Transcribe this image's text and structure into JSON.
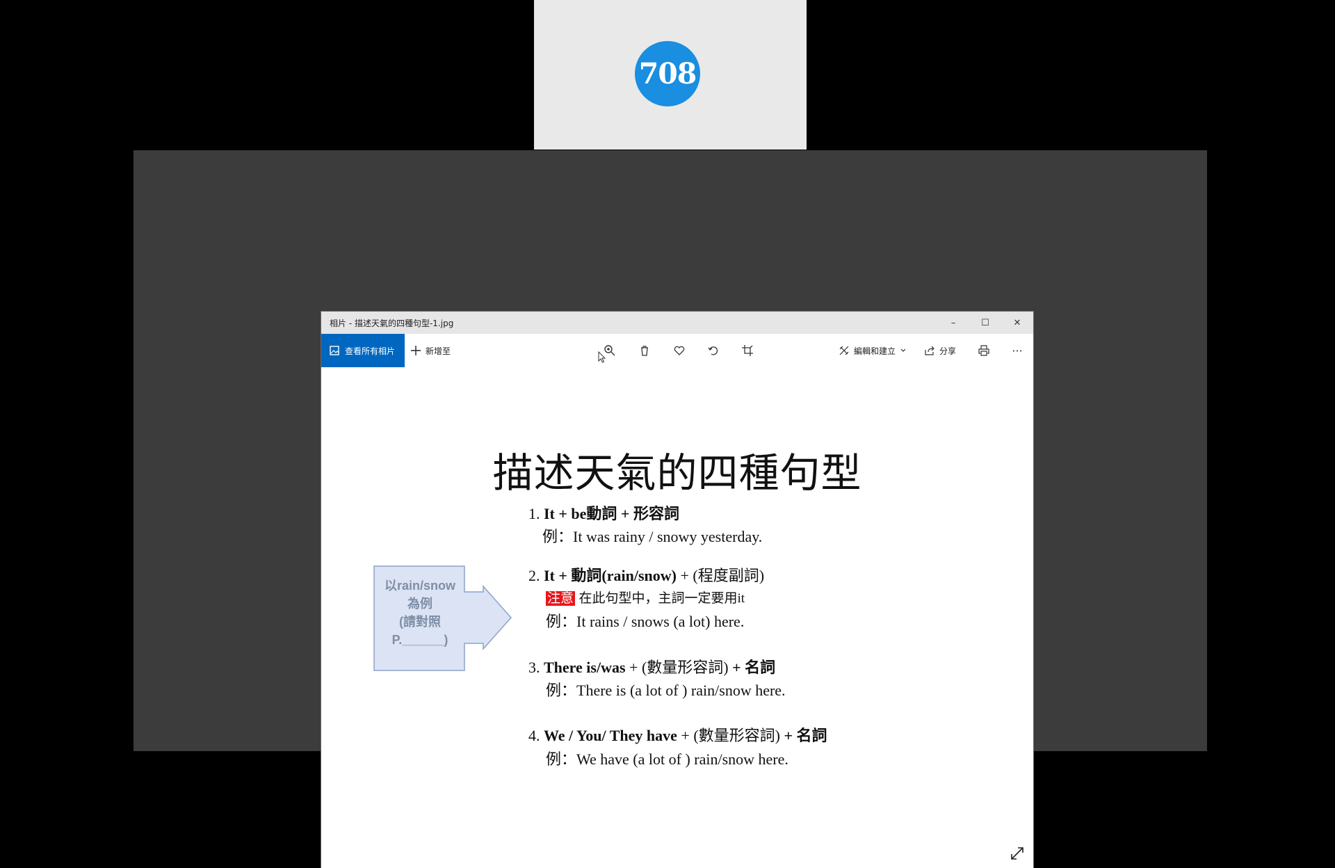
{
  "participant": {
    "name_tile": "708",
    "accent": "#1a8ee0"
  },
  "window": {
    "title": "相片 - 描述天氣的四種句型-1.jpg",
    "controls": {
      "minimize": "–",
      "maximize": "☐",
      "close": "✕"
    }
  },
  "toolbar": {
    "view_all_label": "查看所有相片",
    "add_to_label": "新增至",
    "icons": [
      "zoom-icon",
      "delete-icon",
      "favorite-icon",
      "rotate-icon",
      "crop-icon"
    ],
    "edit_create_label": "編輯和建立",
    "share_label": "分享",
    "more_label": "···"
  },
  "slide": {
    "title": "描述天氣的四種句型",
    "items": [
      {
        "number": "1.",
        "pattern_bold": "It  + be動詞 + 形容詞",
        "pattern_rest": "",
        "example": "例：It was rainy / snowy yesterday."
      },
      {
        "number": "2.",
        "pattern_bold": "It + 動詞(rain/snow)",
        "pattern_rest": " + (程度副詞)",
        "note_tag": "注意",
        "note_text": "在此句型中，主詞一定要用it",
        "example": "例：It rains / snows (a lot) here."
      },
      {
        "number": "3.",
        "pattern_bold": "There is/was",
        "pattern_rest": " + (數量形容詞)",
        "pattern_end": "  + 名詞",
        "example": "例：There is (a lot of ) rain/snow here."
      },
      {
        "number": "4.",
        "pattern_bold": "We / You/ They have",
        "pattern_rest": " + (數量形容詞)",
        "pattern_end": "  + 名詞",
        "example": "例：We have (a lot of ) rain/snow here."
      }
    ],
    "arrow_note": {
      "line1": "以rain/snow",
      "line2": "為例",
      "line3": "(請對照",
      "line4": "P.______)"
    }
  },
  "colors": {
    "accent_button": "#0067c0",
    "note_red": "#e8161a",
    "arrow_fill": "#dbe3f4",
    "arrow_stroke": "#8ea3c8"
  }
}
